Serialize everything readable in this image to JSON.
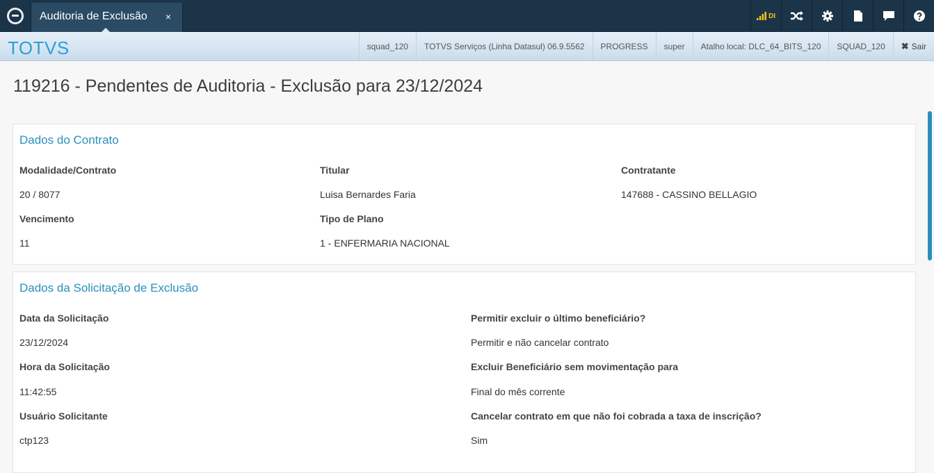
{
  "tab": {
    "label": "Auditoria de Exclusão",
    "close": "×"
  },
  "top_icons": [
    "signal-icon",
    "shuffle-icon",
    "gear-icon",
    "document-icon",
    "chat-icon",
    "help-icon"
  ],
  "signal_label": "DI",
  "brand": "TOTVS",
  "info": {
    "alias": "squad_120",
    "product": "TOTVS Serviços (Linha Datasul) 06.9.5562",
    "database": "PROGRESS",
    "user": "super",
    "shortcut": "Atalho local: DLC_64_BITS_120",
    "environment": "SQUAD_120",
    "exit_label": "Sair"
  },
  "page_title": "119216 - Pendentes de Auditoria - Exclusão para 23/12/2024",
  "contrato": {
    "title": "Dados do Contrato",
    "modalidade_label": "Modalidade/Contrato",
    "modalidade_value": "20 / 8077",
    "titular_label": "Titular",
    "titular_value": "Luisa Bernardes Faria",
    "contratante_label": "Contratante",
    "contratante_value": "147688 - CASSINO BELLAGIO",
    "vencimento_label": "Vencimento",
    "vencimento_value": "11",
    "plano_label": "Tipo de Plano",
    "plano_value": "1 - ENFERMARIA NACIONAL"
  },
  "solicitacao": {
    "title": "Dados da Solicitação de Exclusão",
    "data_label": "Data da Solicitação",
    "data_value": "23/12/2024",
    "hora_label": "Hora da Solicitação",
    "hora_value": "11:42:55",
    "usuario_label": "Usuário Solicitante",
    "usuario_value": "ctp123",
    "permitir_label": "Permitir excluir o último beneficiário?",
    "permitir_value": "Permitir e não cancelar contrato",
    "excluir_label": "Excluir Beneficiário sem movimentação para",
    "excluir_value": "Final do mês corrente",
    "cancelar_label": "Cancelar contrato em que não foi cobrada a taxa de inscrição?",
    "cancelar_value": "Sim"
  },
  "colors": {
    "topbar": "#1c3448",
    "tab": "#2b4a63",
    "brand": "#2e9fd8",
    "section_title": "#2a8fbd"
  }
}
